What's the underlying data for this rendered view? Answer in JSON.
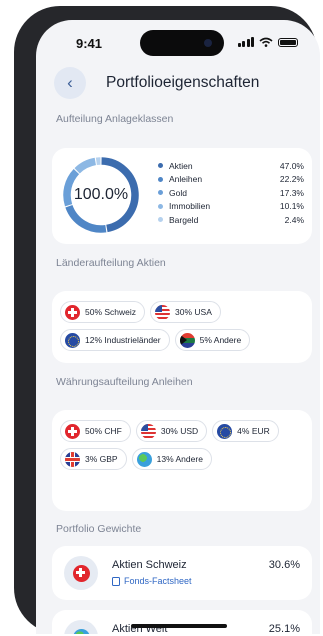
{
  "status_bar": {
    "time": "9:41"
  },
  "header": {
    "back_label": "‹",
    "title": "Portfolioeigenschaften"
  },
  "allocation": {
    "section_label": "Aufteilung Anlageklassen",
    "total": "100.0%",
    "items": [
      {
        "label": "Aktien",
        "value": "47.0%",
        "percent": 47.0,
        "color": "#3c6cae"
      },
      {
        "label": "Anleihen",
        "value": "22.2%",
        "percent": 22.2,
        "color": "#4f86c6"
      },
      {
        "label": "Gold",
        "value": "17.3%",
        "percent": 17.3,
        "color": "#6a9fd8"
      },
      {
        "label": "Immobilien",
        "value": "10.1%",
        "percent": 10.1,
        "color": "#8db8e4"
      },
      {
        "label": "Bargeld",
        "value": "2.4%",
        "percent": 2.4,
        "color": "#b5d1ee"
      }
    ]
  },
  "countries": {
    "section_label": "Länderaufteilung Aktien",
    "chips": [
      {
        "label": "50% Schweiz",
        "icon": "swiss-flag-icon"
      },
      {
        "label": "30% USA",
        "icon": "us-flag-icon"
      },
      {
        "label": "12% Industrieländer",
        "icon": "eu-flag-icon"
      },
      {
        "label": "5% Andere",
        "icon": "south-africa-flag-icon"
      }
    ]
  },
  "currencies": {
    "section_label": "Währungsaufteilung Anleihen",
    "chips": [
      {
        "label": "50% CHF",
        "icon": "swiss-flag-icon"
      },
      {
        "label": "30% USD",
        "icon": "us-flag-icon"
      },
      {
        "label": "4% EUR",
        "icon": "eu-flag-icon"
      },
      {
        "label": "3% GBP",
        "icon": "uk-flag-icon"
      },
      {
        "label": "13% Andere",
        "icon": "globe-icon"
      }
    ]
  },
  "weights": {
    "section_label": "Portfolio Gewichte",
    "items": [
      {
        "name": "Aktien Schweiz",
        "value": "30.6%",
        "link": "Fonds-Factsheet",
        "icon": "swiss-flag-icon"
      },
      {
        "name": "Aktien Welt",
        "value": "25.1%",
        "icon": "globe-icon"
      }
    ]
  },
  "colors": {
    "accent": "#3c6cae",
    "link": "#2f67c4",
    "background": "#f3f4f7"
  }
}
